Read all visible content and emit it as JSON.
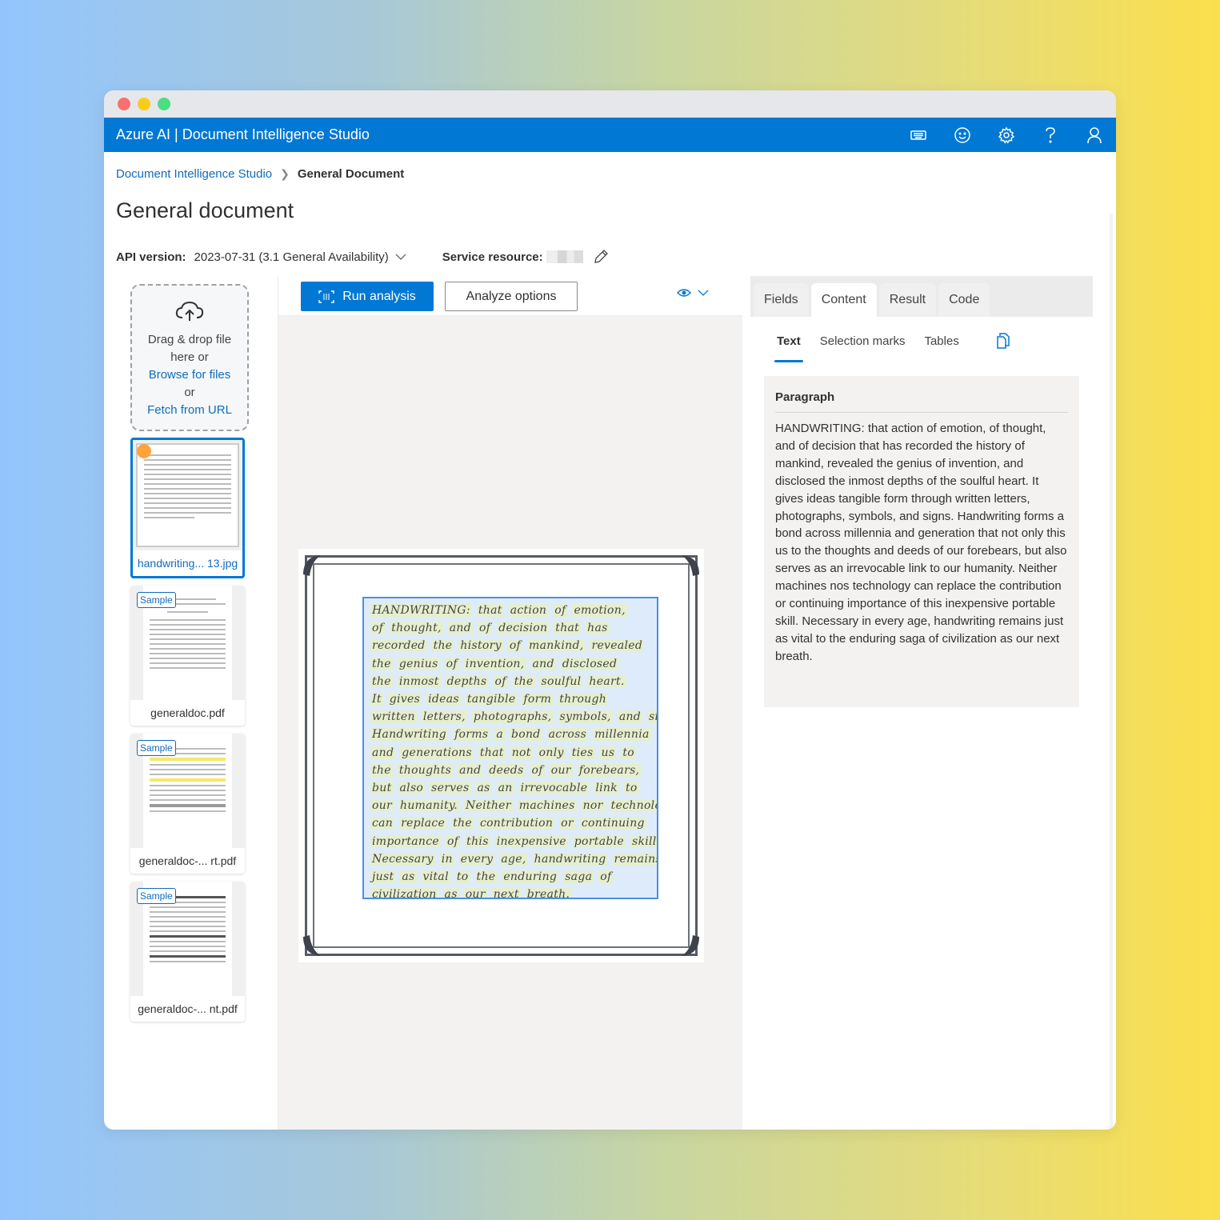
{
  "window": {
    "traffic_lights": [
      "#f87171",
      "#facc15",
      "#4ade80"
    ]
  },
  "header": {
    "title": "Azure AI | Document Intelligence Studio",
    "brand_color": "#0078d4",
    "icons": [
      "keyboard-icon",
      "feedback-smiley-icon",
      "settings-gear-icon",
      "help-icon",
      "account-icon"
    ]
  },
  "breadcrumb": {
    "root": "Document Intelligence Studio",
    "current": "General Document"
  },
  "page": {
    "title": "General document",
    "api_version_label": "API version:",
    "api_version_value": "2023-07-31 (3.1 General Availability)",
    "service_resource_label": "Service resource:"
  },
  "upload": {
    "line1": "Drag & drop file",
    "line2": "here or",
    "browse": "Browse for files",
    "or": "or",
    "fetch": "Fetch from URL"
  },
  "files": [
    {
      "name": "handwriting... 13.jpg",
      "sample": false,
      "selected": true
    },
    {
      "name": "generaldoc.pdf",
      "sample": true,
      "selected": false
    },
    {
      "name": "generaldoc-... rt.pdf",
      "sample": true,
      "selected": false
    },
    {
      "name": "generaldoc-... nt.pdf",
      "sample": true,
      "selected": false
    }
  ],
  "sample_badge": "Sample",
  "toolbar": {
    "run_label": "Run analysis",
    "options_label": "Analyze options"
  },
  "document": {
    "handwriting_lines": [
      [
        "HANDWRITING:",
        "that",
        "action",
        "of",
        "emotion,"
      ],
      [
        "of",
        "thought,",
        "and",
        "of",
        "decision",
        "that",
        "has"
      ],
      [
        "recorded",
        "the",
        "history",
        "of",
        "mankind,",
        "revealed"
      ],
      [
        "the",
        "genius",
        "of",
        "invention,",
        "and",
        "disclosed"
      ],
      [
        "the",
        "inmost",
        "depths",
        "of",
        "the",
        "soulful",
        "heart."
      ],
      [
        "It",
        "gives",
        "ideas",
        "tangible",
        "form",
        "through"
      ],
      [
        "written",
        "letters,",
        "photographs,",
        "symbols,",
        "and",
        "signs."
      ],
      [
        "Handwriting",
        "forms",
        "a",
        "bond",
        "across",
        "millennia"
      ],
      [
        "and",
        "generations",
        "that",
        "not",
        "only",
        "ties",
        "us",
        "to"
      ],
      [
        "the",
        "thoughts",
        "and",
        "deeds",
        "of",
        "our",
        "forebears,"
      ],
      [
        "but",
        "also",
        "serves",
        "as",
        "an",
        "irrevocable",
        "link",
        "to"
      ],
      [
        "our",
        "humanity.",
        "Neither",
        "machines",
        "nor",
        "technology"
      ],
      [
        "can",
        "replace",
        "the",
        "contribution",
        "or",
        "continuing"
      ],
      [
        "importance",
        "of",
        "this",
        "inexpensive",
        "portable",
        "skill."
      ],
      [
        "Necessary",
        "in",
        "every",
        "age,",
        "handwriting",
        "remains"
      ],
      [
        "just",
        "as",
        "vital",
        "to",
        "the",
        "enduring",
        "saga",
        "of"
      ],
      [
        "civilization",
        "as",
        "our",
        "next",
        "breath."
      ]
    ]
  },
  "results": {
    "tabs": [
      {
        "label": "Fields",
        "active": false
      },
      {
        "label": "Content",
        "active": true
      },
      {
        "label": "Result",
        "active": false
      },
      {
        "label": "Code",
        "active": false
      }
    ],
    "subtabs": [
      {
        "label": "Text",
        "active": true
      },
      {
        "label": "Selection marks",
        "active": false
      },
      {
        "label": "Tables",
        "active": false
      }
    ],
    "paragraph_heading": "Paragraph",
    "paragraph_text": "HANDWRITING: that action of emotion, of thought, and of decision that has recorded the history of mankind, revealed the genius of invention, and disclosed the inmost depths of the soulful heart. It gives ideas tangible form through written letters, photographs, symbols, and signs. Handwriting forms a bond across millennia and generation that not only this us to the thoughts and deeds of our forebears, but also serves as an irrevocable link to our humanity. Neither machines nos technology can replace the contribution or continuing importance of this inexpensive portable skill. Necessary in every age, handwriting remains just as vital to the enduring saga of civilization as our next breath."
  }
}
